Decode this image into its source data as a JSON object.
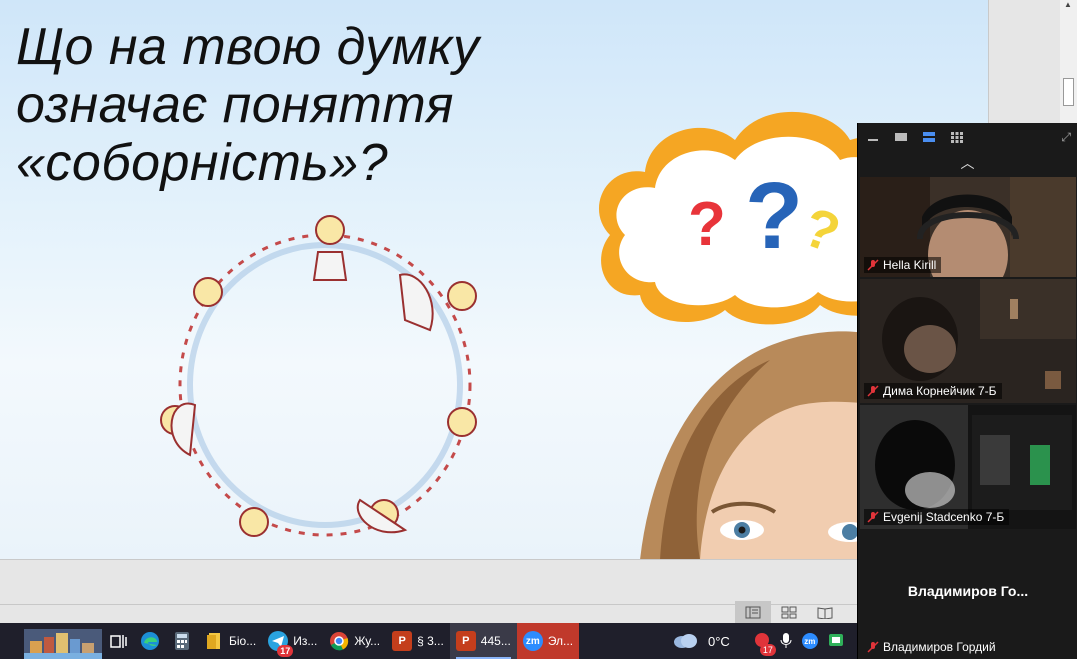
{
  "slide": {
    "title_lines": [
      "Що на твою думку",
      "означає поняття",
      "«соборність»?"
    ]
  },
  "zoom": {
    "participants": [
      {
        "name": "Hella Kirill"
      },
      {
        "name": "Дима Корнейчик 7-Б"
      },
      {
        "name": "Evgenij Stadcenko 7-Б"
      },
      {
        "name": "Владимиров Гордий",
        "display_short": "Владимиров  Го..."
      }
    ]
  },
  "taskbar": {
    "apps": [
      {
        "label": "Біо...",
        "icon": "folder-icon"
      },
      {
        "label": "Из...",
        "icon": "telegram-icon",
        "badge": "17"
      },
      {
        "label": "Жу...",
        "icon": "chrome-icon"
      },
      {
        "label": "§ 3...",
        "icon": "powerpoint-icon"
      },
      {
        "label": "445...",
        "icon": "powerpoint-icon"
      },
      {
        "label": "Эл...",
        "icon": "zoom-icon"
      }
    ],
    "weather": "0°C",
    "tray_badge": "17"
  },
  "colors": {
    "slide_bg": "#d8ecfa",
    "zoom_bg": "#1a1a1a",
    "taskbar_bg": "#1f1f2b",
    "mic_off": "#e0343a",
    "cloud_orange": "#f5a623"
  }
}
